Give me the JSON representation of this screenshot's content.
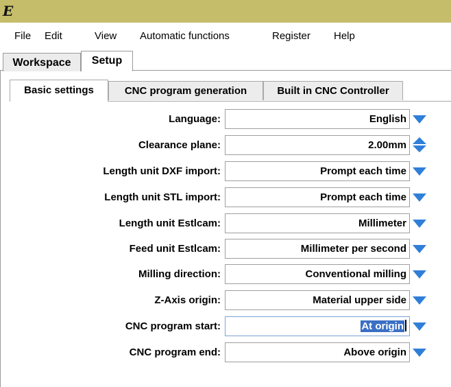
{
  "app": {
    "icon": "estlcam-e-icon",
    "icon_glyph": "E"
  },
  "menu": [
    "File",
    "Edit",
    "View",
    "Automatic functions",
    "Register",
    "Help"
  ],
  "outer_tabs": [
    {
      "label": "Workspace",
      "active": false
    },
    {
      "label": "Setup",
      "active": true
    }
  ],
  "inner_tabs": [
    {
      "label": "Basic settings",
      "active": true
    },
    {
      "label": "CNC program generation",
      "active": false
    },
    {
      "label": "Built in CNC Controller",
      "active": false
    }
  ],
  "settings": [
    {
      "label": "Language:",
      "value": "English",
      "control": "dropdown"
    },
    {
      "label": "Clearance plane:",
      "value": "2.00mm",
      "control": "spinner"
    },
    {
      "label": "Length unit DXF import:",
      "value": "Prompt each time",
      "control": "dropdown"
    },
    {
      "label": "Length unit STL import:",
      "value": "Prompt each time",
      "control": "dropdown"
    },
    {
      "label": "Length unit Estlcam:",
      "value": "Millimeter",
      "control": "dropdown"
    },
    {
      "label": "Feed unit Estlcam:",
      "value": "Millimeter per second",
      "control": "dropdown"
    },
    {
      "label": "Milling direction:",
      "value": "Conventional milling",
      "control": "dropdown"
    },
    {
      "label": "Z-Axis origin:",
      "value": "Material upper side",
      "control": "dropdown"
    },
    {
      "label": "CNC program start:",
      "value": "At origin",
      "control": "dropdown",
      "focused": true,
      "text_selected": true
    },
    {
      "label": "CNC program end:",
      "value": "Above origin",
      "control": "dropdown"
    }
  ],
  "colors": {
    "titlebar": "#c6bd6b",
    "arrow": "#2f7fd8",
    "selection": "#3a6fc4"
  }
}
